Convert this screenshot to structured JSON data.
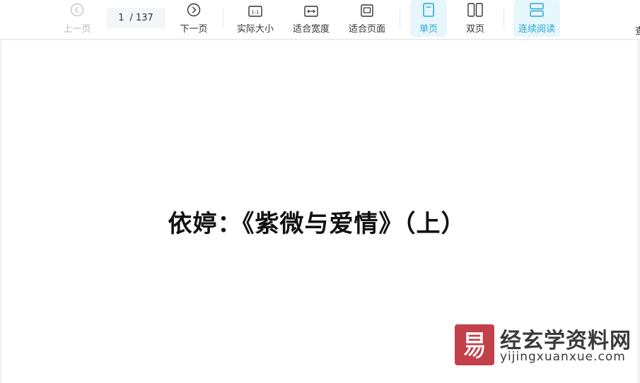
{
  "toolbar": {
    "prev": {
      "label": "上一页",
      "icon": "chevron-left-circle-icon"
    },
    "page": {
      "current": "1",
      "total": "/ 137"
    },
    "next": {
      "label": "下一页",
      "icon": "chevron-right-circle-icon"
    },
    "actual_size": {
      "label": "实际大小",
      "icon": "actual-size-icon",
      "glyph": "1:1"
    },
    "fit_width": {
      "label": "适合宽度",
      "icon": "fit-width-icon"
    },
    "fit_page": {
      "label": "适合页面",
      "icon": "fit-page-icon"
    },
    "single_page": {
      "label": "单页",
      "icon": "single-page-icon"
    },
    "double_page": {
      "label": "双页",
      "icon": "double-page-icon"
    },
    "continuous": {
      "label": "连续阅读",
      "icon": "continuous-read-icon"
    },
    "overflow_label": "查"
  },
  "document": {
    "title": "依婷：《紫微与爱情》（上）"
  },
  "watermark": {
    "name_cn": "经玄学资料网",
    "url": "yijingxuanxue.com"
  },
  "colors": {
    "accent": "#2aa6cf",
    "active_bg": "#e6f6fb",
    "disabled": "#b9b9b9",
    "logo_red": "#c2404a"
  }
}
